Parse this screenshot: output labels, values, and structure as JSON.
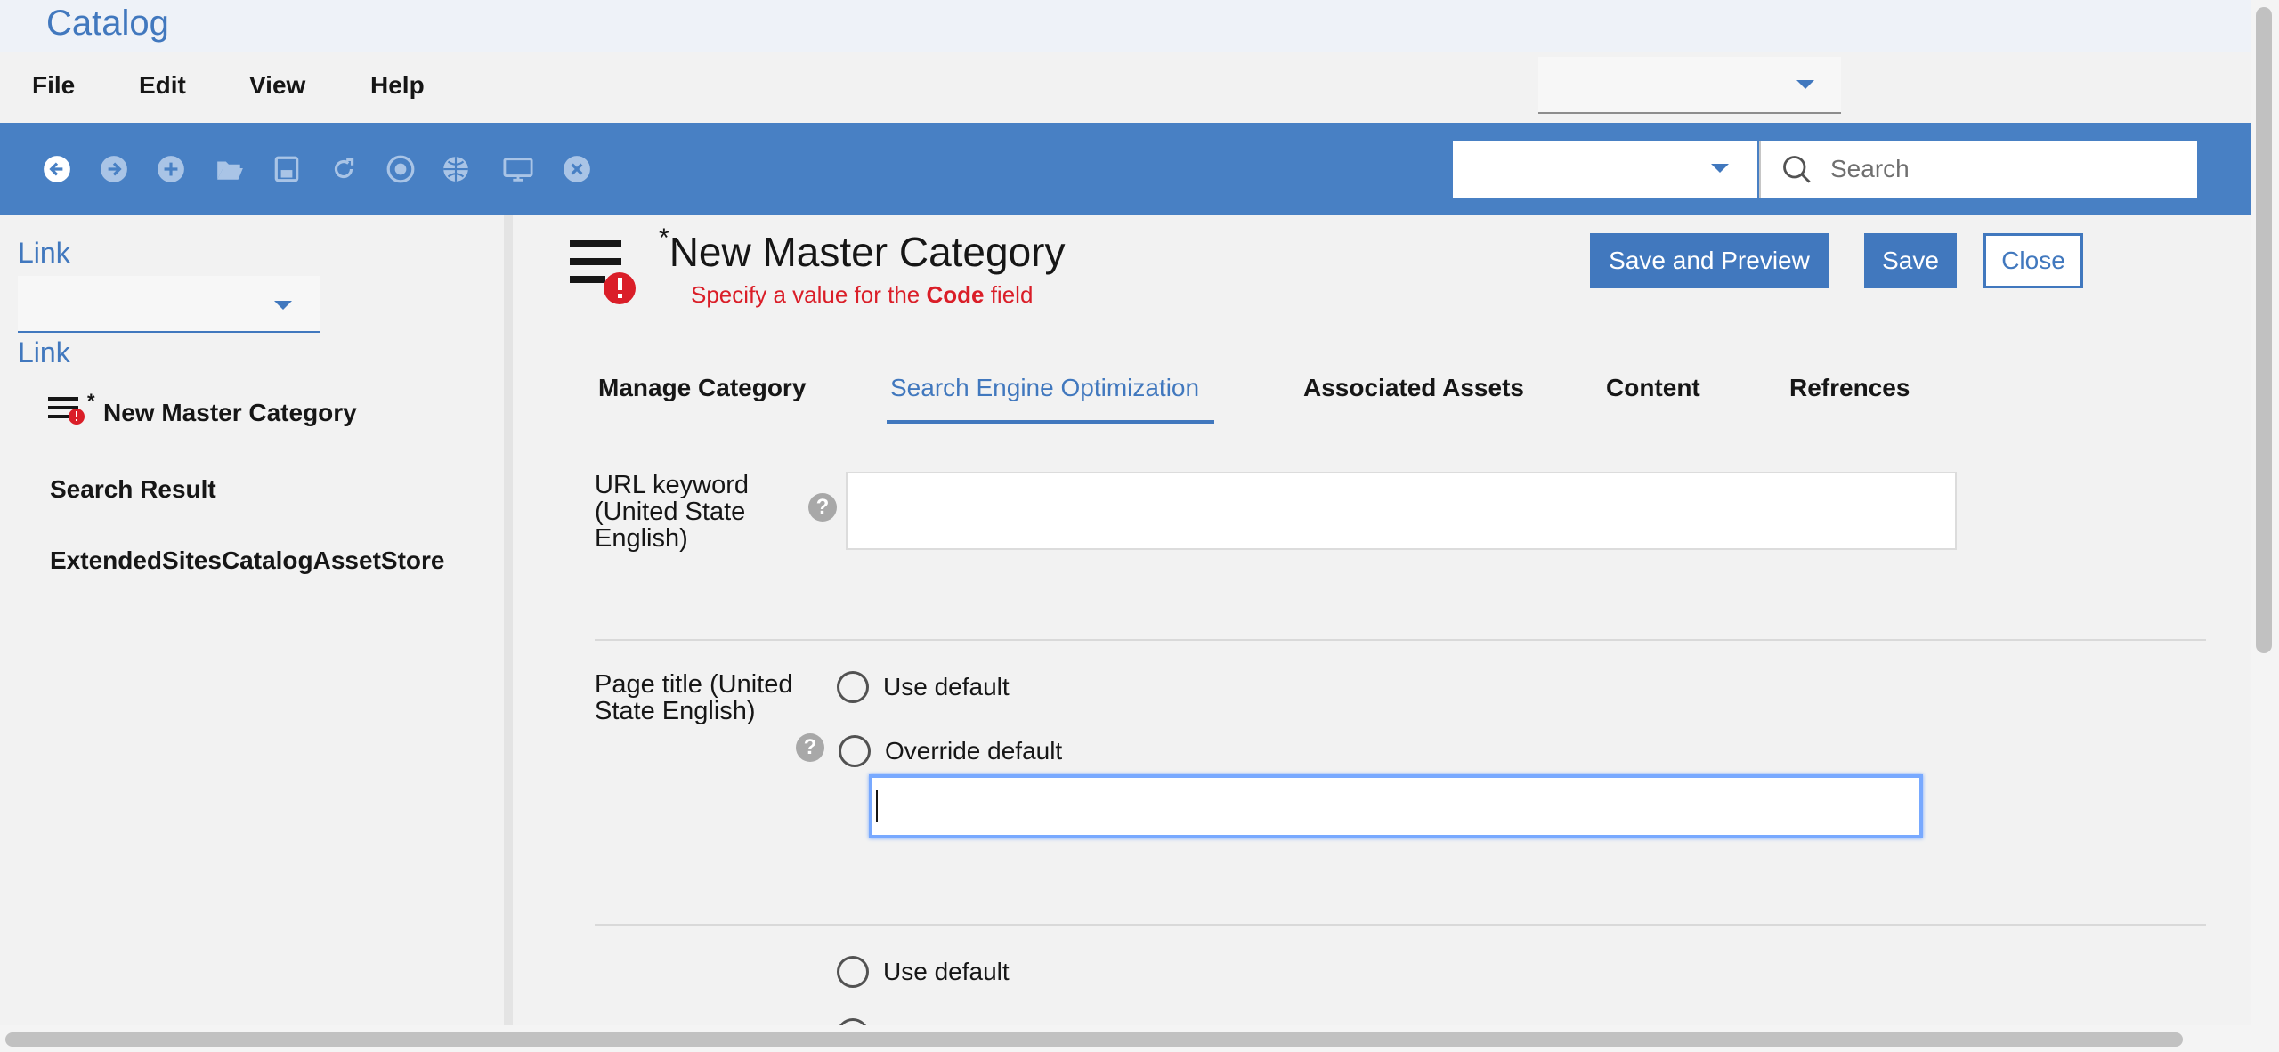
{
  "app": {
    "title": "Catalog"
  },
  "menu": {
    "items": [
      {
        "label": "File"
      },
      {
        "label": "Edit"
      },
      {
        "label": "View"
      },
      {
        "label": "Help"
      }
    ],
    "store_select_value": ""
  },
  "toolbar": {
    "icons": [
      "back-icon",
      "forward-icon",
      "add-icon",
      "open-folder-icon",
      "save-icon",
      "refresh-icon",
      "stop-icon",
      "globe-icon",
      "monitor-icon",
      "cancel-icon"
    ],
    "type_select_value": "",
    "search": {
      "placeholder": "Search",
      "value": ""
    },
    "colors": {
      "background": "#4880c4",
      "icon": "#ffffff"
    }
  },
  "left_panel": {
    "link_top": "Link",
    "select_value": "",
    "link_bottom": "Link",
    "items": [
      {
        "label": "New Master Category",
        "modified_marker": "*"
      },
      {
        "label": "Search Result"
      },
      {
        "label": "ExtendedSitesCatalogAssetStore"
      }
    ]
  },
  "editor": {
    "title_marker": "*",
    "title": "New Master Category",
    "error": {
      "prefix": "Specify a value for the ",
      "field": "Code",
      "suffix": " field"
    },
    "buttons": {
      "save_and_preview": "Save and Preview",
      "save": "Save",
      "close": "Close"
    },
    "tabs": [
      {
        "label": "Manage Category",
        "active": false
      },
      {
        "label": "Search Engine Optimization",
        "active": true
      },
      {
        "label": "Associated Assets",
        "active": false
      },
      {
        "label": "Content",
        "active": false
      },
      {
        "label": "Refrences",
        "active": false
      }
    ],
    "url_keyword": {
      "label_lines": [
        "URL keyword",
        "(United State",
        "English)"
      ],
      "help": "?",
      "value": ""
    },
    "page_title": {
      "label_lines": [
        "Page title (United",
        "State English)"
      ],
      "help": "?",
      "use_default": "Use default",
      "override_default": "Override default",
      "value": ""
    },
    "next_section": {
      "use_default": "Use default"
    },
    "colors": {
      "accent": "#4178be",
      "error": "#da1e28"
    }
  }
}
